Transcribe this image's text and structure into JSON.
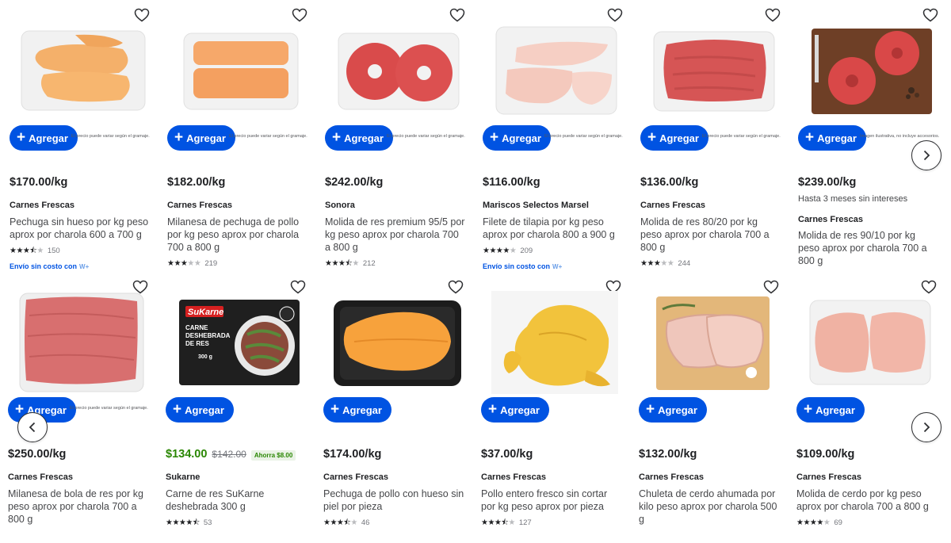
{
  "disclaimers": {
    "weight": "El precio puede variar según el gramaje.",
    "accessories": "Imagen ilustrativa, no incluye accesorios."
  },
  "add_label": "Agregar",
  "nav": {
    "next_icon": "chevron-right-icon",
    "prev_icon": "chevron-left-icon"
  },
  "colors": {
    "accent": "#0053e2",
    "sale": "#2a8703"
  },
  "row1": [
    {
      "price": "$170.00/kg",
      "brand": "Carnes Frescas",
      "title": "Pechuga sin hueso por kg peso aprox por charola 600 a 700 g",
      "rating": 3.5,
      "count": "150",
      "shipping": "Envío sin costo con",
      "wp": "W+"
    },
    {
      "price": "$182.00/kg",
      "brand": "Carnes Frescas",
      "title": "Milanesa de pechuga de pollo por kg peso aprox por charola 700 a 800 g",
      "rating": 3,
      "count": "219"
    },
    {
      "price": "$242.00/kg",
      "brand": "Sonora",
      "title": "Molida de res premium 95/5 por kg peso aprox por charola 700 a 800 g",
      "rating": 3.5,
      "count": "212"
    },
    {
      "price": "$116.00/kg",
      "brand": "Mariscos Selectos Marsel",
      "title": "Filete de tilapia por kg peso aprox por charola 800 a 900 g",
      "rating": 4,
      "count": "209",
      "shipping": "Envío sin costo con",
      "wp": "W+"
    },
    {
      "price": "$136.00/kg",
      "brand": "Carnes Frescas",
      "title": "Molida de res 80/20 por kg peso aprox por charola 700 a 800 g",
      "rating": 3,
      "count": "244"
    },
    {
      "price": "$239.00/kg",
      "promo": "Hasta 3 meses sin intereses",
      "brand": "Carnes Frescas",
      "title": "Molida de res 90/10 por kg peso aprox por charola 700 a 800 g"
    }
  ],
  "row2": [
    {
      "price": "$250.00/kg",
      "brand": "Carnes Frescas",
      "title": "Milanesa de bola de res por kg peso aprox por charola 700 a 800 g"
    },
    {
      "price": "$134.00",
      "was": "$142.00",
      "save": "Ahorra $8.00",
      "brand": "Sukarne",
      "title": "Carne de res SuKarne deshebrada 300 g",
      "rating": 4.5,
      "count": "53",
      "pack_logo": "SuKarne",
      "pack_line1": "CARNE",
      "pack_line2": "DESHEBRADA",
      "pack_line3": "DE RES",
      "pack_weight": "300 g"
    },
    {
      "price": "$174.00/kg",
      "brand": "Carnes Frescas",
      "title": "Pechuga de pollo con hueso sin piel por pieza",
      "rating": 3.5,
      "count": "46"
    },
    {
      "price": "$37.00/kg",
      "brand": "Carnes Frescas",
      "title": "Pollo entero fresco sin cortar por kg peso aprox por pieza",
      "rating": 3.5,
      "count": "127"
    },
    {
      "price": "$132.00/kg",
      "brand": "Carnes Frescas",
      "title": "Chuleta de cerdo ahumada por kilo peso aprox por charola 500 g"
    },
    {
      "price": "$109.00/kg",
      "brand": "Carnes Frescas",
      "title": "Molida de cerdo por kg peso aprox por charola 700 a 800 g",
      "rating": 4,
      "count": "69"
    }
  ]
}
